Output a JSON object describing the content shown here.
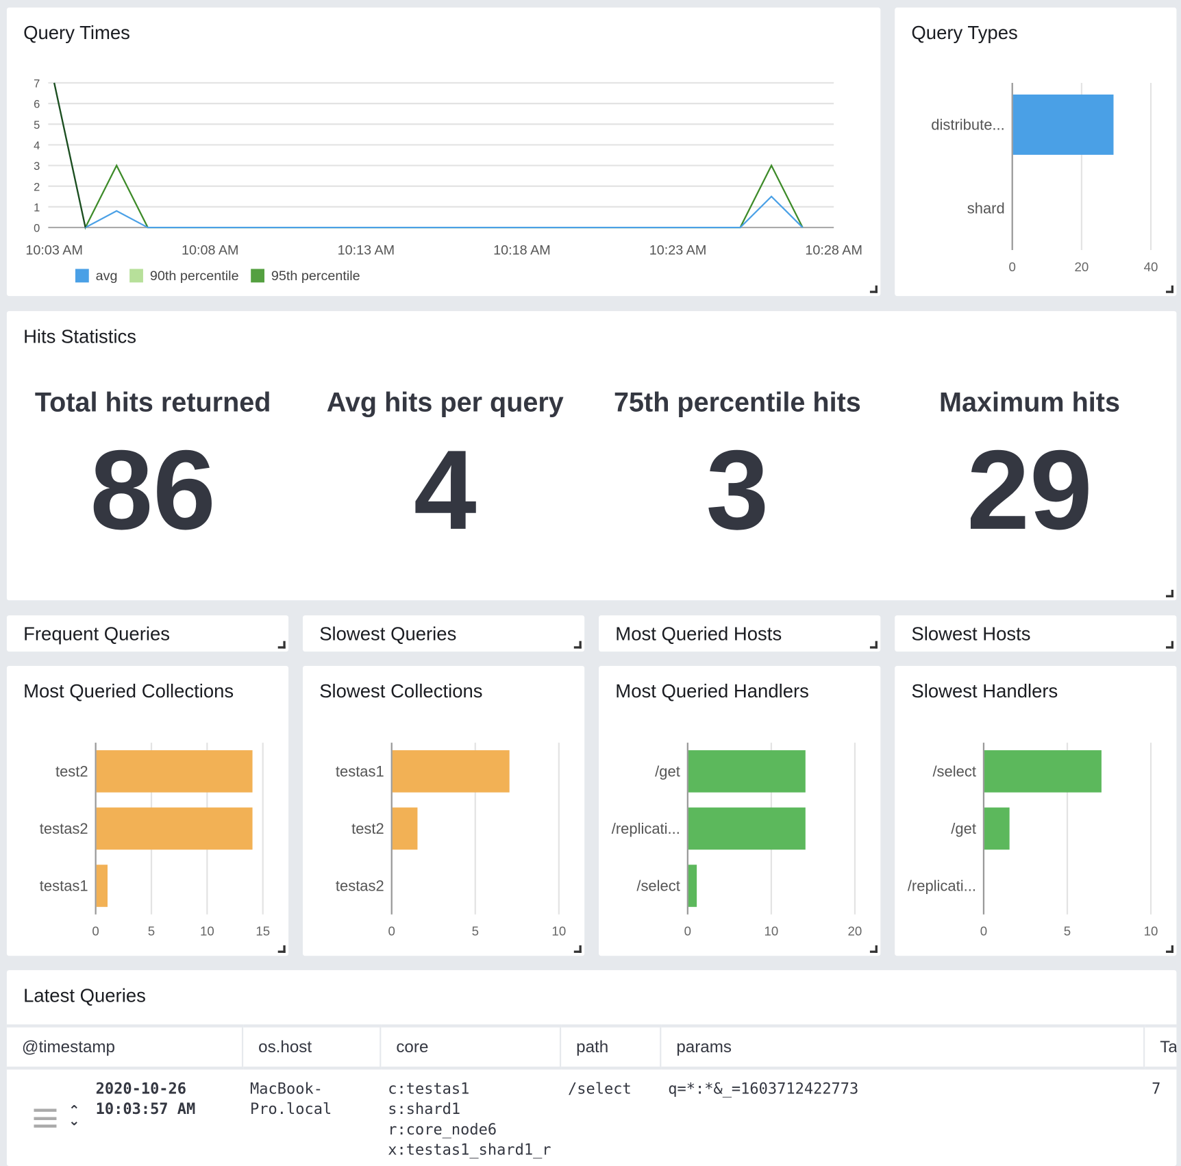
{
  "query_times": {
    "title": "Query Times",
    "chart_data": {
      "type": "line",
      "x": [
        "10:03",
        "10:04",
        "10:05",
        "10:06",
        "10:07",
        "10:08",
        "10:09",
        "10:10",
        "10:11",
        "10:12",
        "10:13",
        "10:14",
        "10:15",
        "10:16",
        "10:17",
        "10:18",
        "10:19",
        "10:20",
        "10:21",
        "10:22",
        "10:23",
        "10:24",
        "10:25",
        "10:26",
        "10:27"
      ],
      "xticks": [
        "10:03 AM",
        "10:08 AM",
        "10:13 AM",
        "10:18 AM",
        "10:23 AM",
        "10:28 AM"
      ],
      "yticks": [
        "0",
        "1",
        "2",
        "3",
        "4",
        "5",
        "6",
        "7"
      ],
      "ylim": [
        0,
        7
      ],
      "grid": true,
      "legend": "bottom-left",
      "series": [
        {
          "name": "avg",
          "color": "#4aa0e6",
          "values": [
            7,
            0,
            0.8,
            0,
            0,
            0,
            0,
            0,
            0,
            0,
            0,
            0,
            0,
            0,
            0,
            0,
            0,
            0,
            0,
            0,
            0,
            0,
            0,
            1.5,
            0
          ]
        },
        {
          "name": "90th percentile",
          "color": "#b7e09a",
          "values": [
            7,
            0,
            3,
            0,
            0,
            0,
            0,
            0,
            0,
            0,
            0,
            0,
            0,
            0,
            0,
            0,
            0,
            0,
            0,
            0,
            0,
            0,
            0,
            3,
            0
          ]
        },
        {
          "name": "95th percentile",
          "color": "#54a040",
          "values": [
            7,
            0,
            3,
            0,
            0,
            0,
            0,
            0,
            0,
            0,
            0,
            0,
            0,
            0,
            0,
            0,
            0,
            0,
            0,
            0,
            0,
            0,
            0,
            3,
            0
          ]
        }
      ]
    }
  },
  "query_types": {
    "title": "Query Types",
    "chart_data": {
      "type": "bar",
      "orientation": "horizontal",
      "categories": [
        "distribute...",
        "shard"
      ],
      "values": [
        29,
        0
      ],
      "xlim": [
        0,
        40
      ],
      "xticks": [
        "0",
        "20",
        "40"
      ],
      "color": "#4aa0e6"
    }
  },
  "hits": {
    "title": "Hits Statistics",
    "stats": [
      {
        "label": "Total hits returned",
        "value": "86"
      },
      {
        "label": "Avg hits per query",
        "value": "4"
      },
      {
        "label": "75th percentile hits",
        "value": "3"
      },
      {
        "label": "Maximum hits",
        "value": "29"
      }
    ]
  },
  "small_panels": [
    "Frequent Queries",
    "Slowest Queries",
    "Most Queried Hosts",
    "Slowest Hosts"
  ],
  "bar_panels": [
    {
      "title": "Most Queried Collections",
      "chart_data": {
        "type": "bar",
        "orientation": "horizontal",
        "categories": [
          "test2",
          "testas2",
          "testas1"
        ],
        "values": [
          14,
          14,
          1
        ],
        "xlim": [
          0,
          15
        ],
        "xticks": [
          "0",
          "5",
          "10",
          "15"
        ],
        "color": "#f2b155"
      }
    },
    {
      "title": "Slowest Collections",
      "chart_data": {
        "type": "bar",
        "orientation": "horizontal",
        "categories": [
          "testas1",
          "test2",
          "testas2"
        ],
        "values": [
          7,
          1.5,
          0
        ],
        "xlim": [
          0,
          10
        ],
        "xticks": [
          "0",
          "5",
          "10"
        ],
        "color": "#f2b155"
      }
    },
    {
      "title": "Most Queried Handlers",
      "chart_data": {
        "type": "bar",
        "orientation": "horizontal",
        "categories": [
          "/get",
          "/replicati...",
          "/select"
        ],
        "values": [
          14,
          14,
          1
        ],
        "xlim": [
          0,
          20
        ],
        "xticks": [
          "0",
          "10",
          "20"
        ],
        "color": "#5cb85c"
      }
    },
    {
      "title": "Slowest Handlers",
      "chart_data": {
        "type": "bar",
        "orientation": "horizontal",
        "categories": [
          "/select",
          "/get",
          "/replicati..."
        ],
        "values": [
          7,
          1.5,
          0
        ],
        "xlim": [
          0,
          10
        ],
        "xticks": [
          "0",
          "5",
          "10"
        ],
        "color": "#5cb85c"
      }
    }
  ],
  "latest": {
    "title": "Latest Queries",
    "columns": [
      "@timestamp",
      "os.host",
      "core",
      "path",
      "params",
      "Ta"
    ],
    "rows": [
      {
        "timestamp_date": "2020-10-26",
        "timestamp_time": "10:03:57 AM",
        "host_1": "MacBook-",
        "host_2": "Pro.local",
        "core": [
          "c:testas1",
          "s:shard1",
          "r:core_node6",
          "x:testas1_shard1_r"
        ],
        "path": "/select",
        "params": "q=*:*&_=1603712422773",
        "ta": "7"
      }
    ]
  }
}
